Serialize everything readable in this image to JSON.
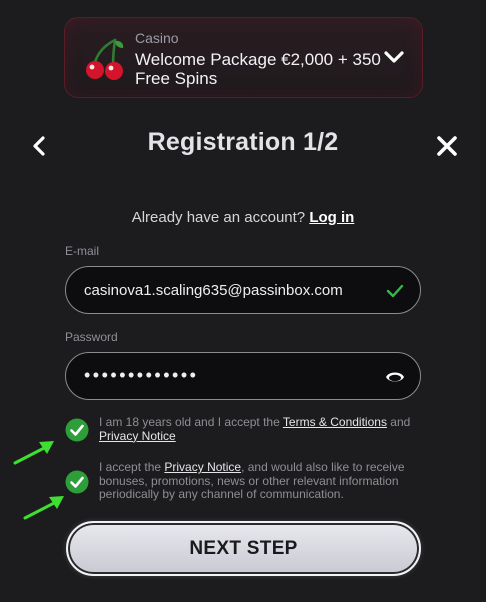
{
  "promo": {
    "category": "Casino",
    "title": "Welcome Package €2,000 + 350 Free Spins"
  },
  "header": {
    "title": "Registration 1/2"
  },
  "login_prompt": {
    "text": "Already have an account?",
    "link": "Log in"
  },
  "email": {
    "label": "E-mail",
    "value": "casinova1.scaling635@passinbox.com"
  },
  "password": {
    "label": "Password",
    "masked": "•••••••••••••"
  },
  "consent_age": {
    "prefix": "I am 18 years old and I accept the",
    "terms_link": "Terms & Conditions",
    "and": "and",
    "privacy_link": "Privacy Notice",
    "checked": true
  },
  "consent_marketing": {
    "prefix": "I accept the",
    "privacy_link": "Privacy Notice",
    "suffix": ", and would also like to receive bonuses, promotions, news or other relevant information periodically by any channel of communication.",
    "checked": true
  },
  "next_button": {
    "label": "NEXT STEP"
  },
  "colors": {
    "check_green": "#2e9e3a",
    "arrow_green": "#3de02f",
    "promo_border": "#5a1c26"
  },
  "icons": [
    "cherry-icon",
    "chevron-down-icon",
    "chevron-left-icon",
    "close-icon",
    "checkmark-icon",
    "eye-icon",
    "check-circle-icon",
    "arrow-icon"
  ]
}
